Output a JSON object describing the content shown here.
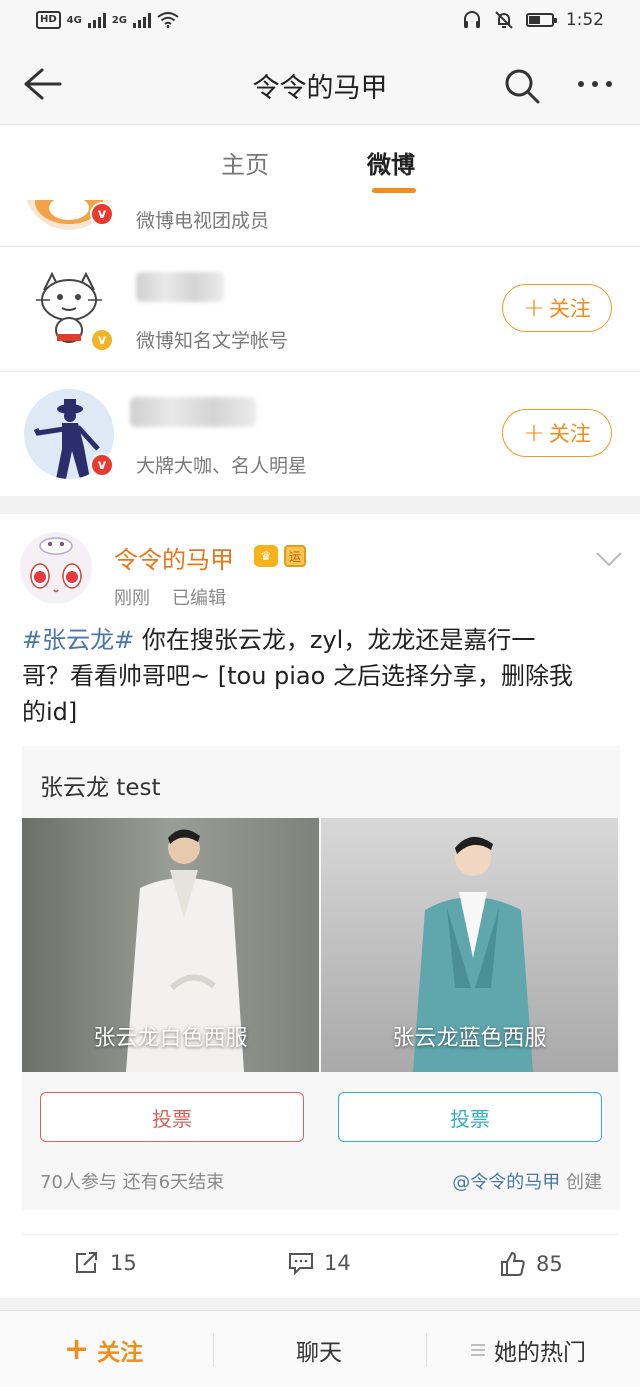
{
  "status_bar": {
    "network": "HD",
    "sim1": "4G",
    "sim2": "2G",
    "time": "1:52",
    "icons": [
      "headset-icon",
      "mute-bell-icon",
      "battery-icon",
      "wifi-icon",
      "signal-icon"
    ]
  },
  "header": {
    "title": "令令的马甲",
    "icons": [
      "back-arrow-icon",
      "search-icon",
      "more-icon"
    ]
  },
  "tabs": [
    {
      "label": "主页",
      "active": false
    },
    {
      "label": "微博",
      "active": true
    }
  ],
  "follow_list": [
    {
      "description": "微博电视团成员",
      "badge": "v",
      "badge_color": "#e63b2e"
    },
    {
      "description": "微博知名文学帐号",
      "badge": "v",
      "badge_color": "#f0b429",
      "button": "关注"
    },
    {
      "description": "大牌大咖、名人明星",
      "badge": "v",
      "badge_color": "#e63b2e",
      "button": "关注"
    }
  ],
  "post": {
    "author": "令令的马甲",
    "time": "刚刚",
    "edited": "已编辑",
    "hashtag": "#张云龙#",
    "text_line1": " 你在搜张云龙，zyl，龙龙还是嘉行一",
    "text_line2": "哥？看看帅哥吧~ [tou piao 之后选择分享，删除我",
    "text_line3": "的id]",
    "poll": {
      "title": "张云龙 test",
      "options": [
        {
          "label": "张云龙白色西服",
          "button": "投票",
          "color": "#e0615b"
        },
        {
          "label": "张云龙蓝色西服",
          "button": "投票",
          "color": "#33b1bd"
        }
      ],
      "stats": "70人参与  还有6天结束",
      "creator_at": "@令令的马甲",
      "creator_suffix": " 创建"
    },
    "actions": {
      "reposts": "15",
      "comments": "14",
      "likes": "85"
    }
  },
  "bottom_bar": {
    "follow": "关注",
    "chat": "聊天",
    "hot": "她的热门"
  },
  "colors": {
    "accent_orange": "#f28c1a",
    "link_blue": "#4a76a8"
  }
}
